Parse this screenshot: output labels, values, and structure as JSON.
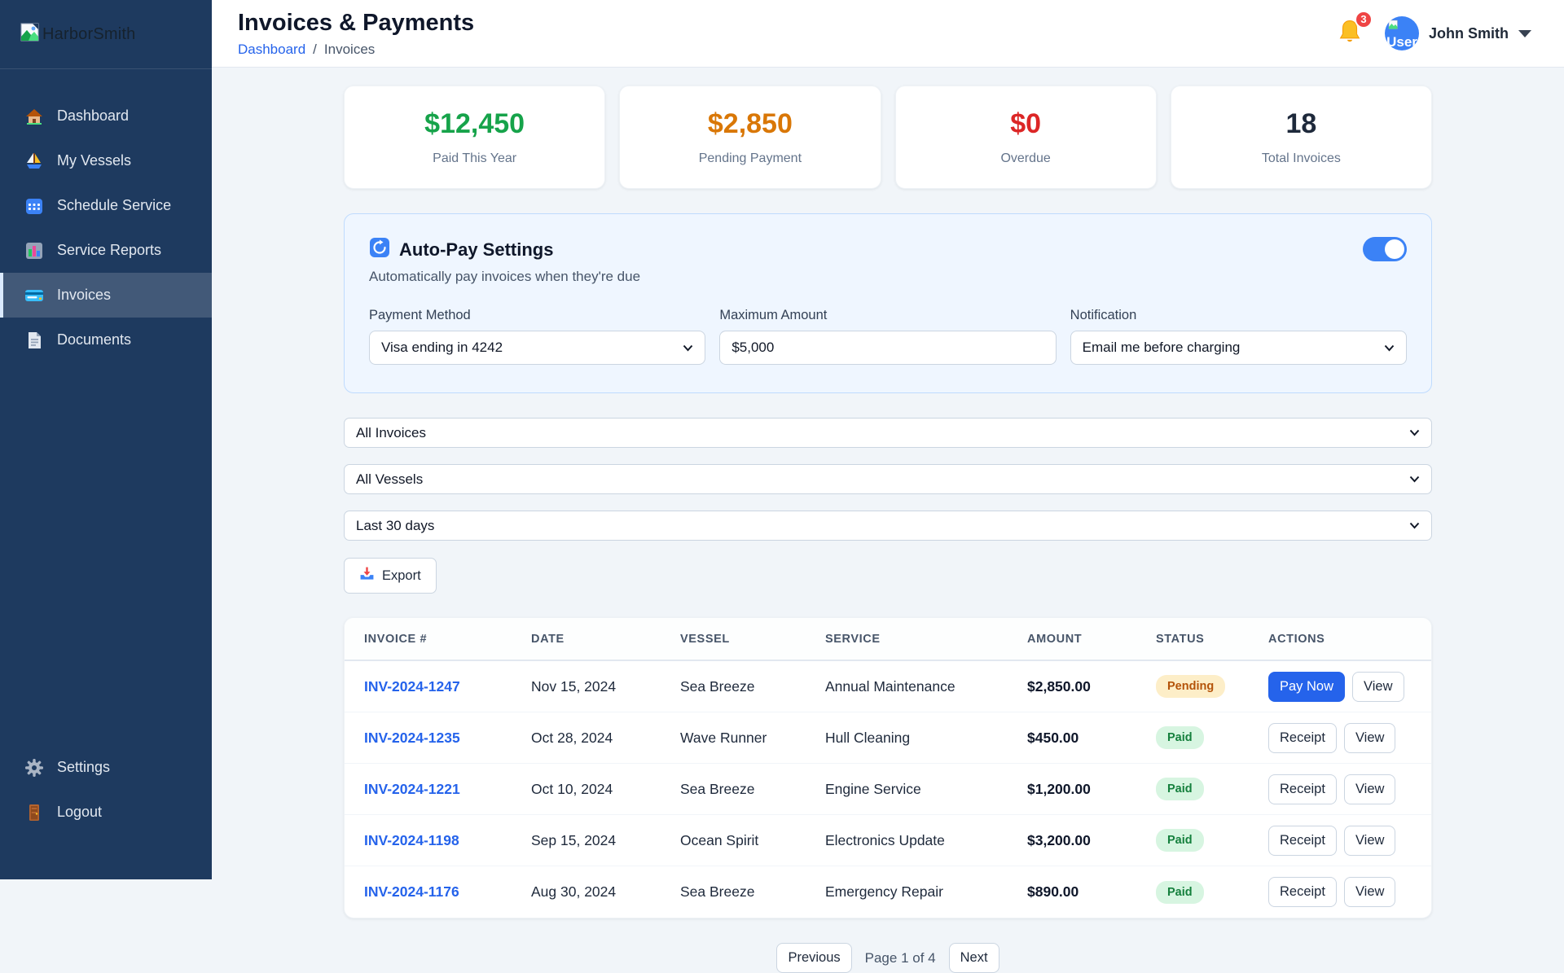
{
  "sidebar": {
    "logo_alt": "HarborSmith",
    "items": [
      {
        "icon": "house-icon",
        "label": "Dashboard",
        "active": false
      },
      {
        "icon": "sailboat-icon",
        "label": "My Vessels",
        "active": false
      },
      {
        "icon": "calendar-icon",
        "label": "Schedule Service",
        "active": false
      },
      {
        "icon": "bar-chart-icon",
        "label": "Service Reports",
        "active": false
      },
      {
        "icon": "credit-card-icon",
        "label": "Invoices",
        "active": true
      },
      {
        "icon": "document-icon",
        "label": "Documents",
        "active": false
      }
    ],
    "footer_items": [
      {
        "icon": "gear-icon",
        "label": "Settings"
      },
      {
        "icon": "door-icon",
        "label": "Logout"
      }
    ]
  },
  "header": {
    "title": "Invoices & Payments",
    "breadcrumb": {
      "link": "Dashboard",
      "separator": "/",
      "current": "Invoices"
    },
    "notifications_count": "3",
    "avatar_alt": "User",
    "user_name": "John Smith"
  },
  "stats": [
    {
      "value": "$12,450",
      "label": "Paid This Year",
      "color": "#16a34a"
    },
    {
      "value": "$2,850",
      "label": "Pending Payment",
      "color": "#d97706"
    },
    {
      "value": "$0",
      "label": "Overdue",
      "color": "#dc2626"
    },
    {
      "value": "18",
      "label": "Total Invoices",
      "color": "#1e293b"
    }
  ],
  "autopay": {
    "title": "Auto-Pay Settings",
    "subtitle": "Automatically pay invoices when they're due",
    "toggle_on": true,
    "fields": [
      {
        "label": "Payment Method",
        "type": "select",
        "value": "Visa ending in 4242"
      },
      {
        "label": "Maximum Amount",
        "type": "input",
        "value": "$5,000"
      },
      {
        "label": "Notification",
        "type": "select",
        "value": "Email me before charging"
      }
    ]
  },
  "filters": [
    {
      "value": "All Invoices"
    },
    {
      "value": "All Vessels"
    },
    {
      "value": "Last 30 days"
    }
  ],
  "export_label": "Export",
  "table": {
    "columns": [
      "INVOICE #",
      "DATE",
      "VESSEL",
      "SERVICE",
      "AMOUNT",
      "STATUS",
      "ACTIONS"
    ],
    "rows": [
      {
        "invoice": "INV-2024-1247",
        "date": "Nov 15, 2024",
        "vessel": "Sea Breeze",
        "service": "Annual Maintenance",
        "amount": "$2,850.00",
        "status": "Pending",
        "actions": [
          {
            "label": "Pay Now",
            "style": "primary"
          },
          {
            "label": "View",
            "style": "outline"
          }
        ]
      },
      {
        "invoice": "INV-2024-1235",
        "date": "Oct 28, 2024",
        "vessel": "Wave Runner",
        "service": "Hull Cleaning",
        "amount": "$450.00",
        "status": "Paid",
        "actions": [
          {
            "label": "Receipt",
            "style": "outline"
          },
          {
            "label": "View",
            "style": "outline"
          }
        ]
      },
      {
        "invoice": "INV-2024-1221",
        "date": "Oct 10, 2024",
        "vessel": "Sea Breeze",
        "service": "Engine Service",
        "amount": "$1,200.00",
        "status": "Paid",
        "actions": [
          {
            "label": "Receipt",
            "style": "outline"
          },
          {
            "label": "View",
            "style": "outline"
          }
        ]
      },
      {
        "invoice": "INV-2024-1198",
        "date": "Sep 15, 2024",
        "vessel": "Ocean Spirit",
        "service": "Electronics Update",
        "amount": "$3,200.00",
        "status": "Paid",
        "actions": [
          {
            "label": "Receipt",
            "style": "outline"
          },
          {
            "label": "View",
            "style": "outline"
          }
        ]
      },
      {
        "invoice": "INV-2024-1176",
        "date": "Aug 30, 2024",
        "vessel": "Sea Breeze",
        "service": "Emergency Repair",
        "amount": "$890.00",
        "status": "Paid",
        "actions": [
          {
            "label": "Receipt",
            "style": "outline"
          },
          {
            "label": "View",
            "style": "outline"
          }
        ]
      }
    ]
  },
  "pagination": {
    "prev": "Previous",
    "label": "Page 1 of 4",
    "next": "Next"
  },
  "colors": {
    "sidebar_bg": "#1e3a5f",
    "accent_blue": "#2563eb",
    "toggle_on": "#3b82f6",
    "paid_green": "#16a34a",
    "pending_orange": "#d97706",
    "overdue_red": "#dc2626",
    "pending_badge_bg": "#fdeec8",
    "paid_badge_bg": "#d7f5e1",
    "autopay_bg": "#eff6ff",
    "page_bg": "#f1f5f9"
  }
}
